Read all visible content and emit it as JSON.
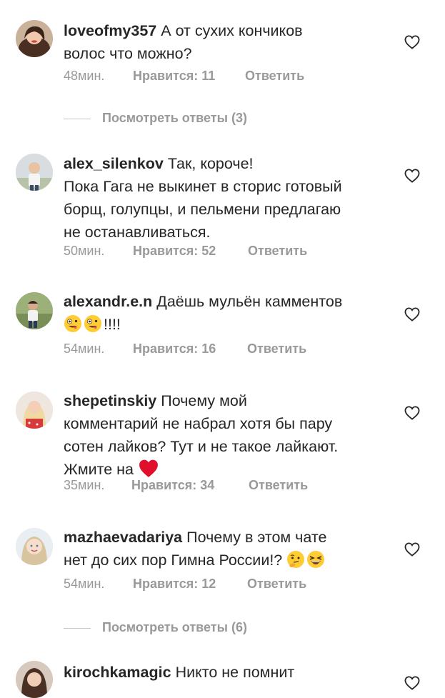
{
  "comments": [
    {
      "username": "loveofmy357",
      "text_lines": [
        "А от сухих кончиков",
        "волос что можно?"
      ],
      "time": "48мин.",
      "likes": "Нравится: 11",
      "reply": "Ответить",
      "avatar": "avatar-woman-dark-hair"
    },
    {
      "username": "alex_silenkov",
      "text_lines": [
        "Так, короче!",
        "Пока Гага не выкинет в сторис готовый",
        "борщ, голупцы, и пельмени предлагаю",
        "не останавливаться."
      ],
      "time": "50мин.",
      "likes": "Нравится: 52",
      "reply": "Ответить",
      "avatar": "avatar-man-outdoor"
    },
    {
      "username": "alexandr.e.n",
      "text_lines": [
        "Даёшь мульён камментов",
        "!!!!"
      ],
      "emojis": [
        "zany-face-emoji",
        "zany-face-emoji"
      ],
      "time": "54мин.",
      "likes": "Нравится: 16",
      "reply": "Ответить",
      "avatar": "avatar-man-park"
    },
    {
      "username": "shepetinskiy",
      "text_lines": [
        "Почему мой",
        "комментарий не набрал хотя бы пару",
        "сотен лайков? Тут и не такое лайкают.",
        "Жмите на"
      ],
      "emojis": [
        "red-heart-emoji"
      ],
      "time": "35мин.",
      "likes": "Нравится: 34",
      "reply": "Ответить",
      "avatar": "avatar-blonde-woman"
    },
    {
      "username": "mazhaevadariya",
      "text_lines": [
        "Почему в этом чате",
        "нет до сих пор Гимна России!?"
      ],
      "emojis": [
        "thinking-face-emoji",
        "laughing-face-emoji"
      ],
      "time": "54мин.",
      "likes": "Нравится: 12",
      "reply": "Ответить",
      "avatar": "avatar-girl-light"
    },
    {
      "username": "kirochkamagic",
      "text_lines": [
        "Никто не помнит"
      ],
      "avatar": "avatar-girl-dark"
    }
  ],
  "view_replies": [
    {
      "label": "Посмотреть ответы (3)"
    },
    {
      "label": "Посмотреть ответы (6)"
    }
  ],
  "colors": {
    "text": "#262626",
    "meta": "#999999",
    "divider": "#c7c7c7",
    "heart_outline": "#262626",
    "emoji_heart": "#e0102d",
    "emoji_face": "#ffcc33"
  },
  "icons": {
    "like": "heart-outline-icon"
  }
}
